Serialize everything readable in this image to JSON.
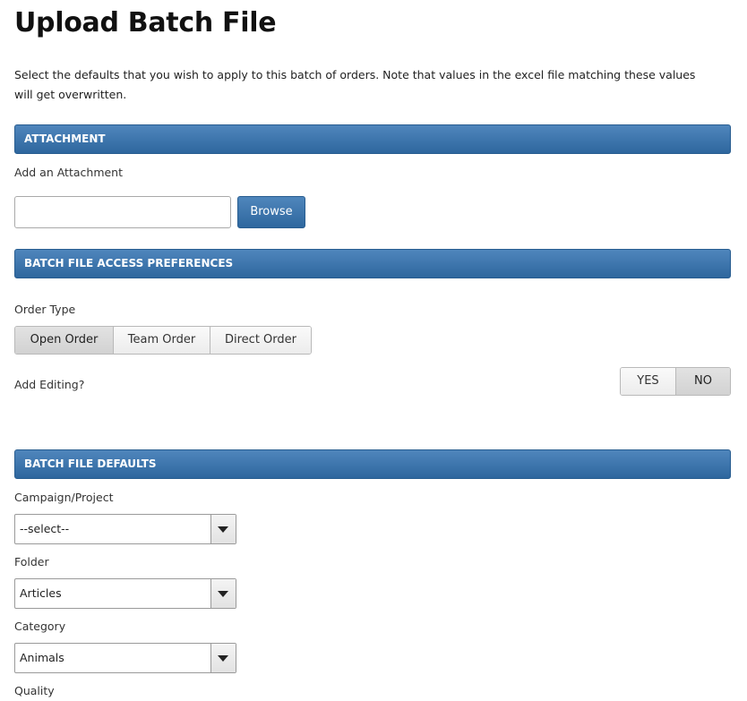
{
  "page": {
    "title": "Upload Batch File",
    "intro": "Select the defaults that you wish to apply to this batch of orders. Note that values in the excel file matching these values will get overwritten."
  },
  "attachment": {
    "header": "ATTACHMENT",
    "label": "Add an Attachment",
    "file_value": "",
    "browse_label": "Browse"
  },
  "access": {
    "header": "BATCH FILE ACCESS PREFERENCES",
    "order_type_label": "Order Type",
    "order_types": [
      "Open Order",
      "Team Order",
      "Direct Order"
    ],
    "selected_order_type": "Open Order",
    "editing_label": "Add Editing?",
    "editing_options": [
      "YES",
      "NO"
    ],
    "editing_selected": "NO"
  },
  "defaults": {
    "header": "BATCH FILE DEFAULTS",
    "campaign_label": "Campaign/Project",
    "campaign_value": "--select--",
    "folder_label": "Folder",
    "folder_value": "Articles",
    "category_label": "Category",
    "category_value": "Animals",
    "quality_label": "Quality"
  },
  "colors": {
    "accent_top": "#4f86bc",
    "accent_bottom": "#2e679e"
  }
}
